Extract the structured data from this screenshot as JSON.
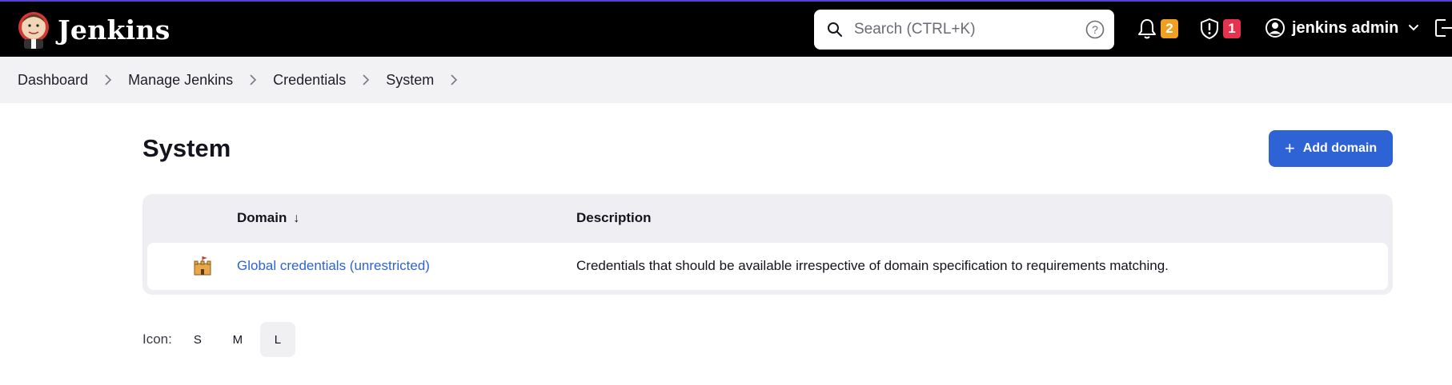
{
  "header": {
    "app_name": "Jenkins",
    "search": {
      "placeholder": "Search (CTRL+K)",
      "value": ""
    },
    "notifications": {
      "count": "2",
      "icon": "bell-icon"
    },
    "security": {
      "count": "1",
      "icon": "shield-alert-icon"
    },
    "user": {
      "name": "jenkins admin",
      "icon": "user-circle-icon"
    },
    "colors": {
      "bar": "#000000",
      "notif_badge": "#f0a020",
      "security_badge": "#e5334d"
    }
  },
  "breadcrumb": {
    "items": [
      {
        "label": "Dashboard"
      },
      {
        "label": "Manage Jenkins"
      },
      {
        "label": "Credentials"
      },
      {
        "label": "System"
      }
    ]
  },
  "main": {
    "title": "System",
    "add_button_label": "Add domain",
    "table": {
      "columns": [
        "Domain",
        "Description"
      ],
      "sort_indicator": "↓",
      "rows": [
        {
          "icon": "domain-castle-icon",
          "domain": "Global credentials (unrestricted)",
          "description": "Credentials that should be available irrespective of domain specification to requirements matching."
        }
      ]
    },
    "icon_size": {
      "label": "Icon:",
      "options": [
        "S",
        "M",
        "L"
      ],
      "selected": "L"
    }
  },
  "colors": {
    "accent": "#2e63d6"
  }
}
